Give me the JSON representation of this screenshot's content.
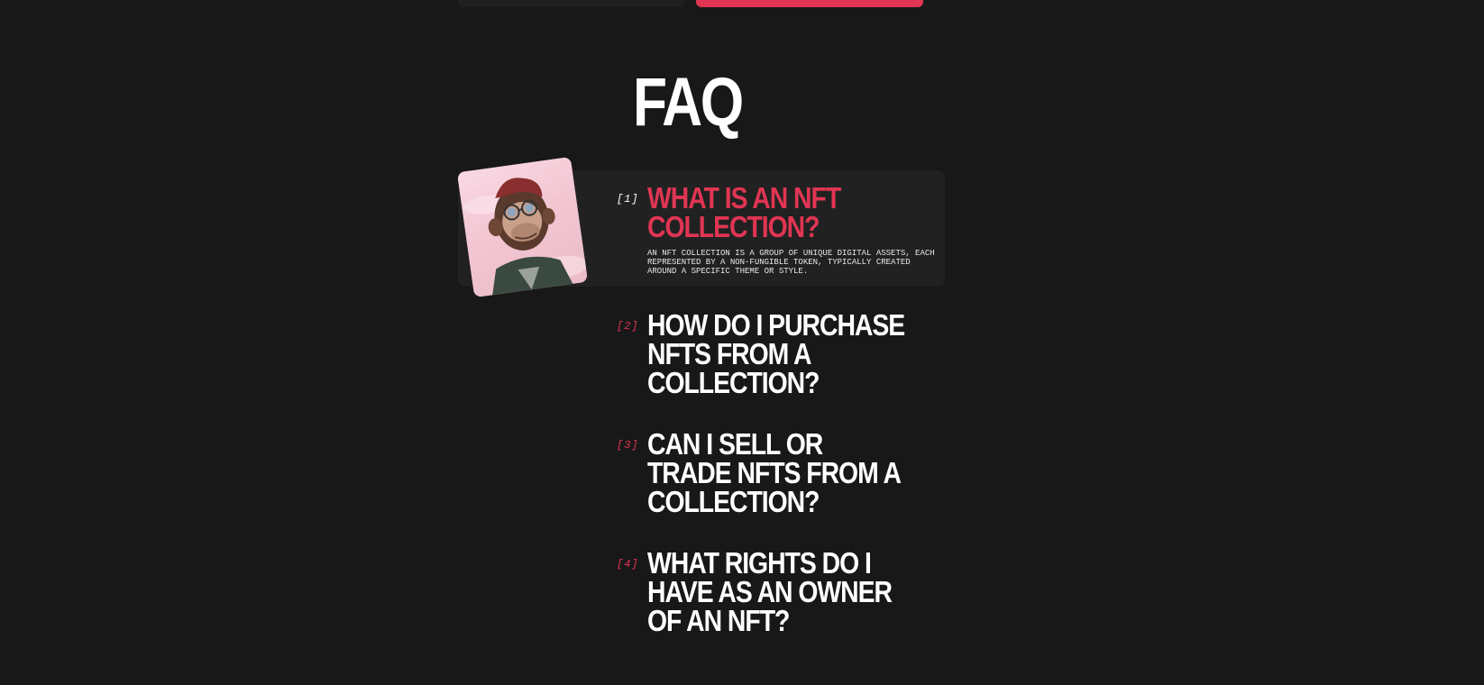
{
  "header": {
    "title": "FAQ"
  },
  "faq": {
    "image_icon": "ape-avatar",
    "items": [
      {
        "number": "[1]",
        "question": "WHAT IS AN NFT COLLECTION?",
        "answer": "AN NFT COLLECTION IS A GROUP OF UNIQUE DIGITAL ASSETS, EACH REPRESENTED BY A NON-FUNGIBLE TOKEN, TYPICALLY CREATED AROUND A SPECIFIC THEME OR STYLE.",
        "expanded": true
      },
      {
        "number": "[2]",
        "question": "HOW DO I PURCHASE NFTS FROM A COLLECTION?",
        "expanded": false
      },
      {
        "number": "[3]",
        "question": "CAN I SELL OR TRADE NFTS FROM A COLLECTION?",
        "expanded": false
      },
      {
        "number": "[4]",
        "question": "WHAT RIGHTS DO I HAVE AS AN OWNER OF AN NFT?",
        "expanded": false
      }
    ]
  },
  "colors": {
    "background": "#181818",
    "card": "#212121",
    "accent": "#e03553",
    "text": "#ffffff"
  }
}
